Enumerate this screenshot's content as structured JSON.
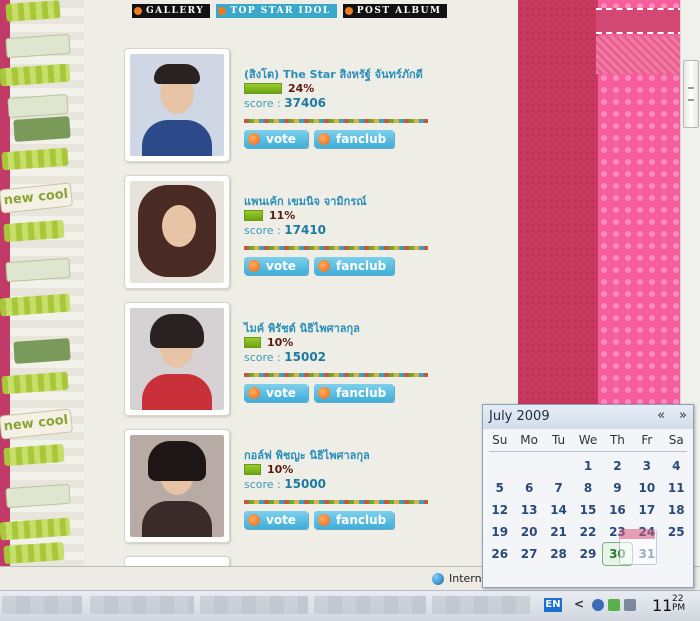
{
  "nav": {
    "items": [
      {
        "label": "GALLERY"
      },
      {
        "label": "TOP STAR IDOL"
      },
      {
        "label": "POST ALBUM"
      }
    ]
  },
  "decor": {
    "badge_text": "new cool"
  },
  "idols": [
    {
      "name": "(สิงโต) The Star สิงหรัฐ์ จันทร์ภักดี",
      "percent": "24%",
      "percent_value": 24,
      "score_label": "score :",
      "score": "37406",
      "vote_label": "vote",
      "fanclub_label": "fanclub"
    },
    {
      "name": "แพนเค้ก เขมนิจ จามิกรณ์",
      "percent": "11%",
      "percent_value": 11,
      "score_label": "score :",
      "score": "17410",
      "vote_label": "vote",
      "fanclub_label": "fanclub"
    },
    {
      "name": "ไมค์ พิรัชต์ นิธิไพศาลกุล",
      "percent": "10%",
      "percent_value": 10,
      "score_label": "score :",
      "score": "15002",
      "vote_label": "vote",
      "fanclub_label": "fanclub"
    },
    {
      "name": "กอล์ฟ พิชญะ นิธิไพศาลกุล",
      "percent": "10%",
      "percent_value": 10,
      "score_label": "score :",
      "score": "15000",
      "vote_label": "vote",
      "fanclub_label": "fanclub"
    }
  ],
  "statusbar": {
    "zone_text": "Intern"
  },
  "taskbar": {
    "lang": "EN",
    "time": "11",
    "time_min": "22",
    "ampm": "PM",
    "chevron": "<"
  },
  "calendar": {
    "title": "July 2009",
    "prev": "«",
    "next": "»",
    "weekdays": [
      "Su",
      "Mo",
      "Tu",
      "We",
      "Th",
      "Fr",
      "Sa"
    ],
    "days": [
      "",
      "",
      "",
      "1",
      "2",
      "3",
      "4",
      "5",
      "6",
      "7",
      "8",
      "9",
      "10",
      "11",
      "12",
      "13",
      "14",
      "15",
      "16",
      "17",
      "18",
      "19",
      "20",
      "21",
      "22",
      "23",
      "24",
      "25",
      "26",
      "27",
      "28",
      "29",
      "30",
      "31",
      ""
    ],
    "today": "30"
  },
  "colors": {
    "accent_blue": "#3aa8c8",
    "pink": "#f55e9a",
    "crimson": "#c8385f",
    "name_color": "#2a8fb8"
  }
}
